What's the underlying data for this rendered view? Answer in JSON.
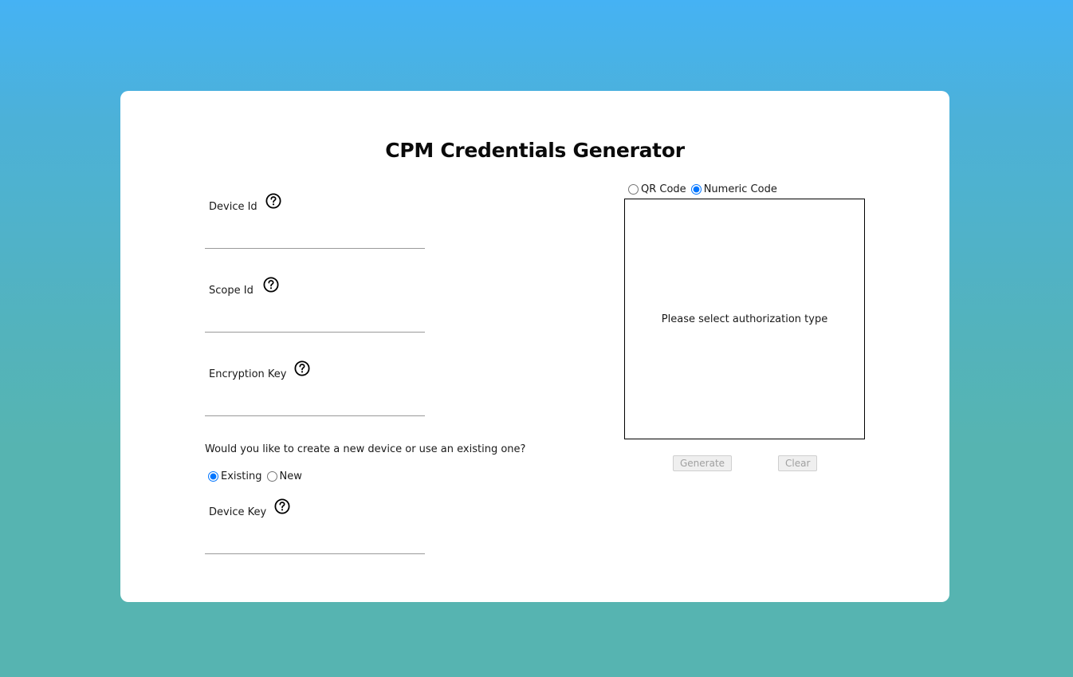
{
  "page": {
    "title": "CPM Credentials Generator"
  },
  "fields": {
    "device_id": {
      "label": "Device Id",
      "value": ""
    },
    "scope_id": {
      "label": "Scope Id",
      "value": ""
    },
    "encryption_key": {
      "label": "Encryption Key",
      "value": ""
    },
    "device_key": {
      "label": "Device Key",
      "value": ""
    }
  },
  "device_choice": {
    "question": "Would you like to create a new device or use an existing one?",
    "options": [
      {
        "label": "Existing",
        "selected": true
      },
      {
        "label": "New",
        "selected": false
      }
    ]
  },
  "auth_type": {
    "options": [
      {
        "label": "QR Code",
        "selected": false
      },
      {
        "label": "Numeric Code",
        "selected": true
      }
    ],
    "placeholder_message": "Please select authorization type"
  },
  "buttons": {
    "generate": "Generate",
    "clear": "Clear"
  },
  "icons": {
    "help": "question-circle-icon"
  },
  "colors": {
    "background_top": "#45b2f4",
    "background_bottom": "#56b4b1",
    "card": "#ffffff",
    "radio_accent": "#1a73e8"
  }
}
